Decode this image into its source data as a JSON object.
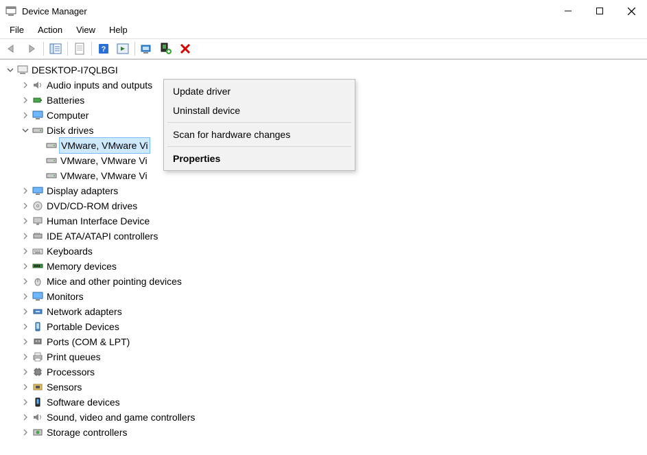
{
  "window": {
    "title": "Device Manager"
  },
  "menu": {
    "file": "File",
    "action": "Action",
    "view": "View",
    "help": "Help"
  },
  "tree": {
    "root": "DESKTOP-I7QLBGI",
    "audio": "Audio inputs and outputs",
    "batteries": "Batteries",
    "computer": "Computer",
    "diskdrives": "Disk drives",
    "disk_child_1": "VMware, VMware Vi",
    "disk_child_2": "VMware, VMware Vi",
    "disk_child_3": "VMware, VMware Vi",
    "display": "Display adapters",
    "dvd": "DVD/CD-ROM drives",
    "hid": "Human Interface Device",
    "ide": "IDE ATA/ATAPI controllers",
    "keyboards": "Keyboards",
    "memory": "Memory devices",
    "mice": "Mice and other pointing devices",
    "monitors": "Monitors",
    "network": "Network adapters",
    "portable": "Portable Devices",
    "ports": "Ports (COM & LPT)",
    "printq": "Print queues",
    "processors": "Processors",
    "sensors": "Sensors",
    "software": "Software devices",
    "sound": "Sound, video and game controllers",
    "storage": "Storage controllers"
  },
  "contextmenu": {
    "update": "Update driver",
    "uninstall": "Uninstall device",
    "scan": "Scan for hardware changes",
    "properties": "Properties"
  }
}
